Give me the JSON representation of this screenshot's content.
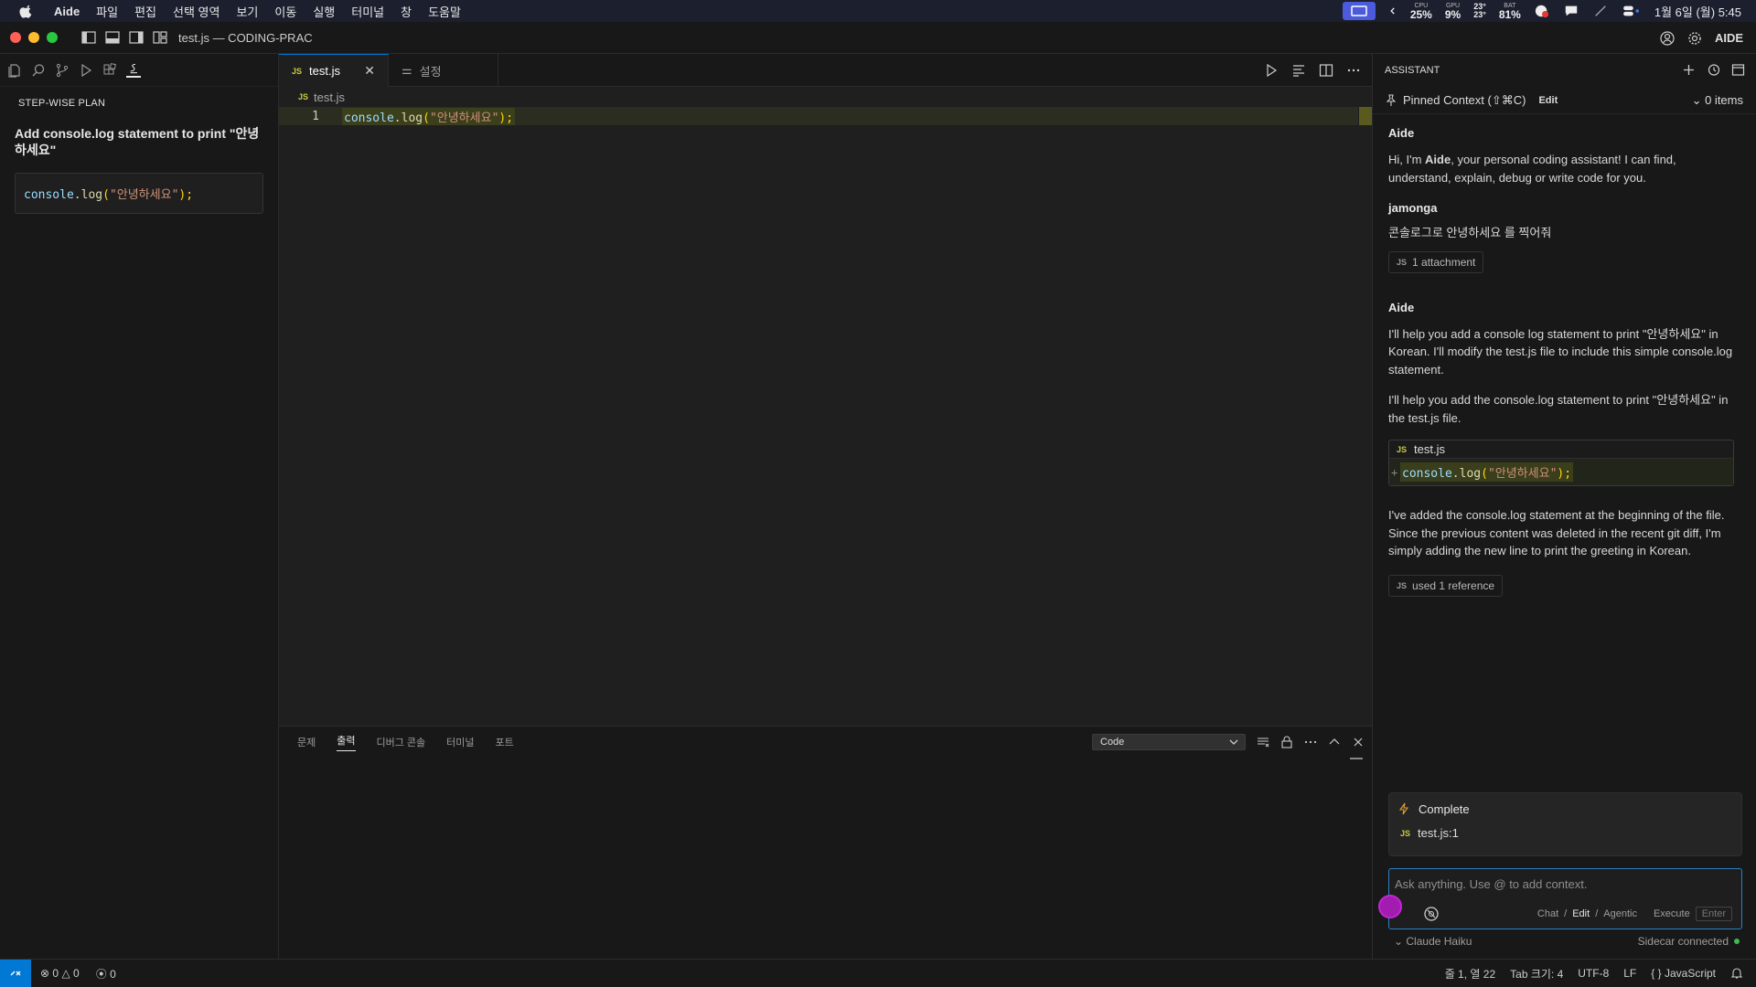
{
  "menubar": {
    "app_name": "Aide",
    "items": [
      "파일",
      "편집",
      "선택 영역",
      "보기",
      "이동",
      "실행",
      "터미널",
      "창",
      "도움말"
    ],
    "stats": [
      {
        "label": "CPU",
        "value": "25%"
      },
      {
        "label": "GPU",
        "value": "9%"
      },
      {
        "label": "",
        "value": "23°\n23°"
      },
      {
        "label": "BAT",
        "value": "81%"
      }
    ],
    "datetime": "1월 6일 (월) 5:45"
  },
  "titlebar": {
    "title": "test.js — CODING-PRAC",
    "brand": "AIDE"
  },
  "sidebar": {
    "section_title": "STEP-WISE PLAN",
    "step_title": "Add console.log statement to print \"안녕하세요\"",
    "code": {
      "obj": "console",
      "dot": ".",
      "method": "log",
      "open": "(",
      "str": "\"안녕하세요\"",
      "close": ");"
    }
  },
  "editor": {
    "tabs": [
      {
        "badge": "JS",
        "label": "test.js",
        "close": "✕"
      },
      {
        "badge": "⚌",
        "label": "설정"
      }
    ],
    "breadcrumb": {
      "badge": "JS",
      "file": "test.js"
    },
    "line_number": "1",
    "code": {
      "obj": "console",
      "dot": ".",
      "method": "log",
      "open": "(",
      "str": "\"안녕하세요\"",
      "close": ");"
    }
  },
  "panel": {
    "tabs": [
      "문제",
      "출력",
      "디버그 콘솔",
      "터미널",
      "포트"
    ],
    "active_tab": "출력",
    "output_select": "Code"
  },
  "assistant": {
    "header": "ASSISTANT",
    "pinned_label": "Pinned Context (⇧⌘C)",
    "pinned_edit": "Edit",
    "pinned_items": "0 items",
    "messages": {
      "m1_author": "Aide",
      "m1_pre": "Hi, I'm ",
      "m1_bold": "Aide",
      "m1_post": ", your personal coding assistant! I can find, understand, explain, debug or write code for you.",
      "m2_author": "jamonga",
      "m2_text": "콘솔로그로 안녕하세요 를 찍어줘",
      "m2_chip": "1 attachment",
      "m3_author": "Aide",
      "m3_p1": "I'll help you add a console log statement to print \"안녕하세요\" in Korean. I'll modify the test.js file to include this simple console.log statement.",
      "m3_p2": "I'll help you add the console.log statement to print \"안녕하세요\" in the test.js file.",
      "m3_card_file": "test.js",
      "m3_card_plus": "+",
      "m3_p3": "I've added the console.log statement at the beginning of the file. Since the previous content was deleted in the recent git diff, I'm simply adding the new line to print the greeting in Korean.",
      "m3_chip": "used 1 reference"
    },
    "complete_label": "Complete",
    "complete_file": "test.js:1",
    "input_placeholder": "Ask anything. Use @ to add context.",
    "modes": [
      "Chat",
      "/",
      "Edit",
      "/",
      "Agentic"
    ],
    "execute_label": "Execute",
    "enter_label": "Enter",
    "model": "Claude Haiku",
    "sidecar": "Sidecar connected"
  },
  "statusbar": {
    "errors": "0",
    "warnings": "0",
    "ports": "0",
    "position": "줄 1, 열 22",
    "tab_size": "Tab 크기: 4",
    "encoding": "UTF-8",
    "eol": "LF",
    "language": "JavaScript"
  },
  "colors": {
    "accent": "#0078d4",
    "js_badge": "#cbcb41",
    "purple": "#a21caf"
  }
}
